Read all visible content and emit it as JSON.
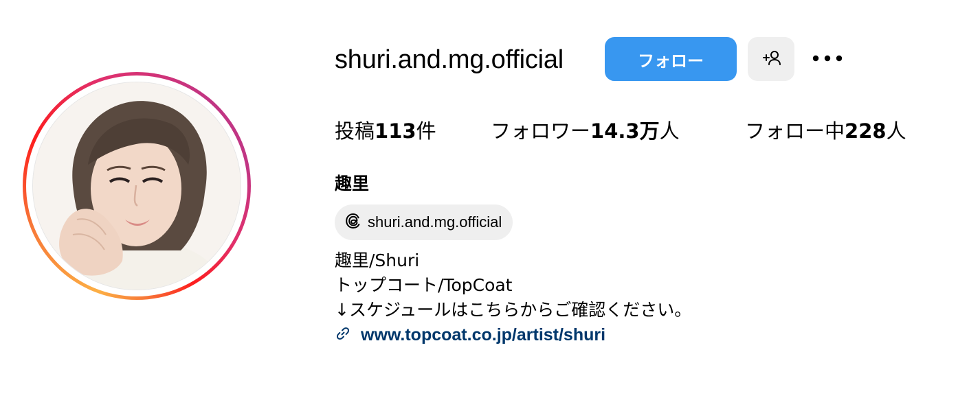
{
  "profile": {
    "username": "shuri.and.mg.official",
    "follow_label": "フォロー",
    "display_name": "趣里"
  },
  "stats": {
    "posts_prefix": "投稿",
    "posts_count": "113",
    "posts_suffix": "件",
    "followers_prefix": "フォロワー",
    "followers_count": "14.3万",
    "followers_suffix": "人",
    "following_prefix": "フォロー中",
    "following_count": "228",
    "following_suffix": "人"
  },
  "threads": {
    "handle": "shuri.and.mg.official",
    "icon": "threads-icon"
  },
  "bio": {
    "lines": [
      "趣里/Shuri",
      "トップコート/TopCoat",
      "↓スケジュールはこちらからご確認ください。"
    ]
  },
  "link": {
    "url_text": "www.topcoat.co.jp/artist/shuri",
    "icon": "link-icon"
  },
  "icons": {
    "suggest": "add-person-icon",
    "more": "more-options-icon"
  },
  "colors": {
    "follow_button": "#3897f0",
    "secondary_button": "#efefef",
    "link": "#00376b"
  }
}
